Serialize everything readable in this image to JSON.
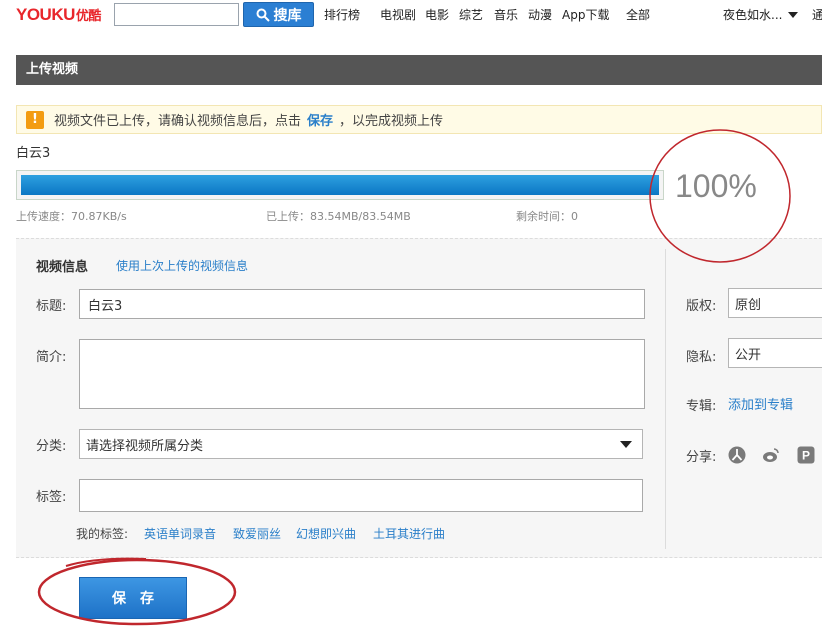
{
  "topbar": {
    "logo_text": "YOUKU",
    "logo_cn": "优酷",
    "search_placeholder": "",
    "search_button": "搜库",
    "nav_items": [
      "排行榜",
      "电视剧",
      "电影",
      "综艺",
      "音乐",
      "动漫",
      "App下载",
      "全部"
    ],
    "user_name": "夜色如水...",
    "nav_extra": "通"
  },
  "page": {
    "section_title": "上传视频",
    "notice_prefix": "视频文件已上传，请确认视频信息后，点击",
    "notice_link": "保存",
    "notice_suffix": "，以完成视频上传"
  },
  "upload": {
    "file_name": "白云3",
    "progress": 1.0,
    "percent_text": "100%",
    "speed": "上传速度：70.87KB/s",
    "uploaded": "已上传：83.54MB/83.54MB",
    "remaining": "剩余时间：0"
  },
  "form": {
    "section_title": "视频信息",
    "reuse_link": "使用上次上传的视频信息",
    "title_label": "标题:",
    "title_value": "白云3",
    "desc_label": "简介:",
    "category_label": "分类:",
    "category_value": "请选择视频所属分类",
    "tags_label": "标签:",
    "tags_value": "",
    "my_tags_label": "我的标签:",
    "my_tags": [
      "英语单词录音",
      "致爱丽丝",
      "幻想即兴曲",
      "土耳其进行曲"
    ]
  },
  "side": {
    "copyright_label": "版权:",
    "copyright_value": "原创",
    "privacy_label": "隐私:",
    "privacy_value": "公开",
    "album_label": "专辑:",
    "album_link": "添加到专辑",
    "share_label": "分享:",
    "share_icons": [
      "renren-icon",
      "weibo-icon",
      "qq-icon"
    ]
  },
  "actions": {
    "save_label": "保存"
  },
  "colors": {
    "brand_red": "#e8262b",
    "link_blue": "#2a7fc9",
    "progress_blue": "#0b77c4",
    "annotation_red": "#c0272d"
  }
}
